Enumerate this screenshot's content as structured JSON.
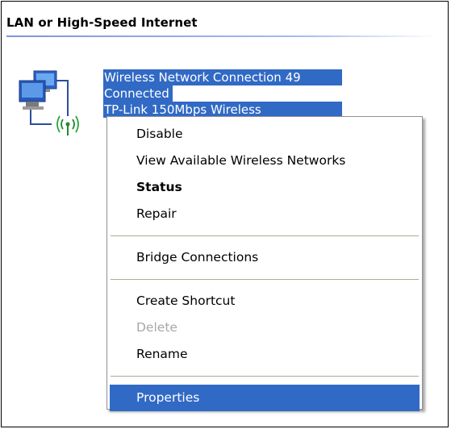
{
  "group": {
    "header": "LAN or High-Speed Internet"
  },
  "connection": {
    "name": "Wireless Network Connection 49",
    "status": "Connected",
    "device": "TP-Link 150Mbps Wireless"
  },
  "context_menu": {
    "disable": "Disable",
    "view_networks": "View Available Wireless Networks",
    "status": "Status",
    "repair": "Repair",
    "bridge": "Bridge Connections",
    "create_shortcut": "Create Shortcut",
    "delete": "Delete",
    "rename": "Rename",
    "properties": "Properties"
  },
  "colors": {
    "selection": "#316ac5",
    "disabled_text": "#a7a7a7"
  },
  "icons": [
    "network-computers-icon",
    "wireless-signal-icon"
  ]
}
